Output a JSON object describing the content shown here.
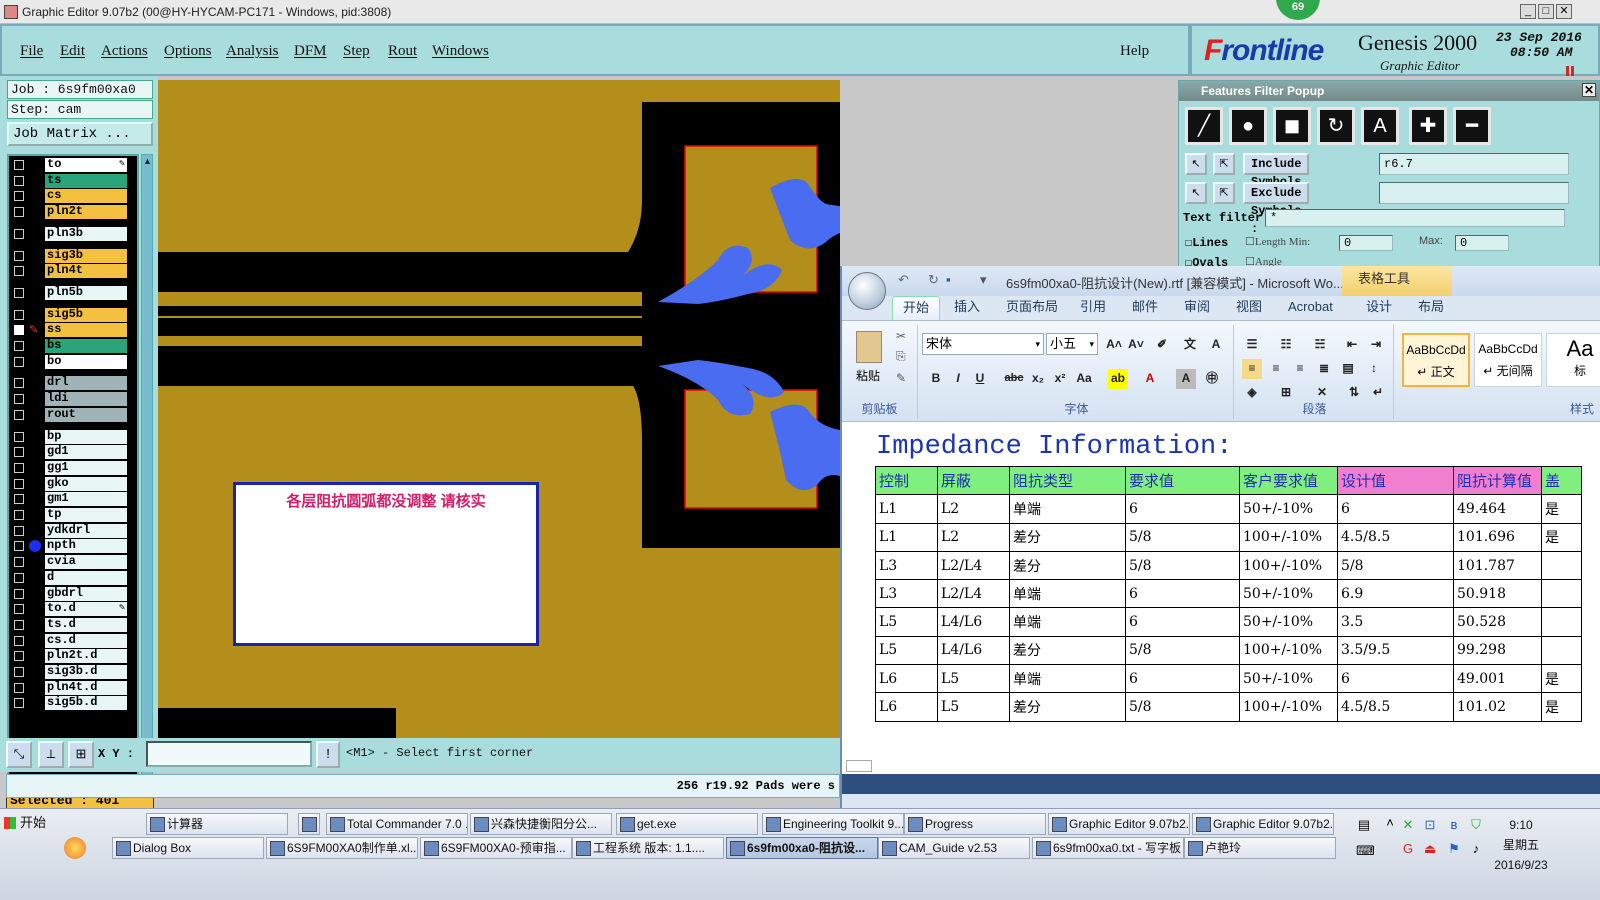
{
  "titlebar": {
    "title": "Graphic Editor 9.07b2 (00@HY-HYCAM-PC171 - Windows, pid:3808)",
    "badge": "69"
  },
  "menu": {
    "items": [
      "File",
      "Edit",
      "Actions",
      "Options",
      "Analysis",
      "DFM",
      "Step",
      "Rout",
      "Windows"
    ],
    "help": "Help"
  },
  "brand": {
    "logo": "Frontline",
    "product": "Genesis 2000",
    "subtitle": "Graphic Editor",
    "date": "23 Sep 2016",
    "time": "08:50 AM"
  },
  "job": {
    "job_line": "Job : 6s9fm00xa0",
    "step_line": "Step: cam",
    "matrix_button": "Job Matrix ..."
  },
  "layers": [
    {
      "name": "to",
      "color": "#ffffff",
      "marker": "✎"
    },
    {
      "name": "ts",
      "color": "#2aa47a"
    },
    {
      "name": "cs",
      "color": "#f4c040"
    },
    {
      "name": "pln2t",
      "color": "#f4c040"
    },
    {
      "name": "pln3b",
      "color": "#e8f6f6"
    },
    {
      "name": "sig3b",
      "color": "#f4c040"
    },
    {
      "name": "pln4t",
      "color": "#f4c040"
    },
    {
      "name": "pln5b",
      "color": "#e8f6f6"
    },
    {
      "name": "sig5b",
      "color": "#f4c040"
    },
    {
      "name": "ss",
      "color": "#f4c040",
      "active": true
    },
    {
      "name": "bs",
      "color": "#2aa47a"
    },
    {
      "name": "bo",
      "color": "#ffffff"
    },
    {
      "name": "drl",
      "color": "#a0b4b8"
    },
    {
      "name": "ldi",
      "color": "#a0b4b8"
    },
    {
      "name": "rout",
      "color": "#a0b4b8"
    },
    {
      "name": "bp",
      "color": "#e8f6f6"
    },
    {
      "name": "gd1",
      "color": "#e8f6f6"
    },
    {
      "name": "gg1",
      "color": "#e8f6f6"
    },
    {
      "name": "gko",
      "color": "#e8f6f6"
    },
    {
      "name": "gm1",
      "color": "#e8f6f6"
    },
    {
      "name": "tp",
      "color": "#e8f6f6"
    },
    {
      "name": "ydkdrl",
      "color": "#e8f6f6"
    },
    {
      "name": "npth",
      "color": "#e8f6f6",
      "dot": true
    },
    {
      "name": "cvia",
      "color": "#e8f6f6"
    },
    {
      "name": "d",
      "color": "#e8f6f6"
    },
    {
      "name": "gbdrl",
      "color": "#e8f6f6"
    },
    {
      "name": "to.d",
      "color": "#e8f6f6",
      "marker": "✎"
    },
    {
      "name": "ts.d",
      "color": "#e8f6f6"
    },
    {
      "name": "cs.d",
      "color": "#e8f6f6"
    },
    {
      "name": "pln2t.d",
      "color": "#e8f6f6"
    },
    {
      "name": "sig3b.d",
      "color": "#e8f6f6"
    },
    {
      "name": "pln4t.d",
      "color": "#e8f6f6"
    },
    {
      "name": "sig5b.d",
      "color": "#e8f6f6"
    }
  ],
  "selected": "Selected : 401",
  "canvas": {
    "note_text": "各层阻抗圆弧都没调整  请核实",
    "background": "#b38e1b",
    "copper_color": "#000000",
    "pad_color": "#4a6cf0",
    "outline_color": "#e00000"
  },
  "cmd": {
    "xy_label": "X Y :",
    "xy_value": "",
    "prompt": "<M1> - Select first corner",
    "status": "256 r19.92 Pads were s"
  },
  "filter_popup": {
    "title": "Features Filter Popup",
    "include_label": "Include Symbols :",
    "include_value": "r6.7",
    "exclude_label": "Exclude Symbols :",
    "exclude_value": "",
    "text_filter_label": "Text filter",
    "text_filter_value": "*",
    "lines_label": "Lines",
    "length_label": "Length",
    "min_label": "Min:",
    "max_label": "Max:",
    "min_value": "0",
    "max_value": "0",
    "ovals_label": "Ovals",
    "angle_label": "Angle"
  },
  "word": {
    "title": "6s9fm00xa0-阻抗设计(New).rtf [兼容模式] - Microsoft Wo...",
    "table_tools": "表格工具",
    "tabs": [
      "开始",
      "插入",
      "页面布局",
      "引用",
      "邮件",
      "审阅",
      "视图",
      "Acrobat",
      "设计",
      "布局"
    ],
    "ribbon": {
      "paste": "粘贴",
      "clipboard": "剪贴板",
      "font_name": "宋体",
      "font_size": "小五",
      "font_group": "字体",
      "paragraph_group": "段落",
      "styles_group": "样式",
      "style1_sample": "AaBbCcDd",
      "style1_name": "↵ 正文",
      "style2_sample": "AaBbCcDd",
      "style2_name": "↵ 无间隔",
      "style3_sample": "Aa",
      "style3_name": "标"
    },
    "doc_title": "Impedance Information:",
    "table": {
      "headers": [
        "控制",
        "屏蔽",
        "阻抗类型",
        "要求值",
        "客户要求值",
        "设计值",
        "阻抗计算值",
        "盖"
      ],
      "rows": [
        [
          "L1",
          "L2",
          "单端",
          "6",
          "50+/-10%",
          "6",
          "49.464",
          "是"
        ],
        [
          "L1",
          "L2",
          "差分",
          "5/8",
          "100+/-10%",
          "4.5/8.5",
          "101.696",
          "是"
        ],
        [
          "L3",
          "L2/L4",
          "差分",
          "5/8",
          "100+/-10%",
          "5/8",
          "101.787",
          ""
        ],
        [
          "L3",
          "L2/L4",
          "单端",
          "6",
          "50+/-10%",
          "6.9",
          "50.918",
          ""
        ],
        [
          "L5",
          "L4/L6",
          "单端",
          "6",
          "50+/-10%",
          "3.5",
          "50.528",
          ""
        ],
        [
          "L5",
          "L4/L6",
          "差分",
          "5/8",
          "100+/-10%",
          "3.5/9.5",
          "99.298",
          ""
        ],
        [
          "L6",
          "L5",
          "单端",
          "6",
          "50+/-10%",
          "6",
          "49.001",
          "是"
        ],
        [
          "L6",
          "L5",
          "差分",
          "5/8",
          "100+/-10%",
          "4.5/8.5",
          "101.02",
          "是"
        ]
      ],
      "header_colors": [
        "#7ff07f",
        "#7ff07f",
        "#7ff07f",
        "#7ff07f",
        "#7ff07f",
        "#f07fd0",
        "#f07fd0",
        "#7ff07f"
      ]
    }
  },
  "taskbar": {
    "start": "开始",
    "row1": [
      "计算器",
      "",
      "Total Commander 7.0 ...",
      "兴森快捷衡阳分公...",
      "get.exe",
      "Engineering Toolkit 9....",
      "Progress",
      "Graphic Editor 9.07b2...",
      "Graphic Editor 9.07b2..."
    ],
    "row2": [
      "Dialog Box",
      "6S9FM00XA0制作单.xl...",
      "6S9FM00XA0-预审指...",
      "工程系统  版本: 1.1....",
      "6s9fm00xa0-阻抗设...",
      "CAM_Guide v2.53",
      "6s9fm00xa0.txt - 写字板",
      "卢艳玲"
    ],
    "clock_time": "9:10",
    "clock_day": "星期五",
    "clock_date": "2016/9/23"
  }
}
